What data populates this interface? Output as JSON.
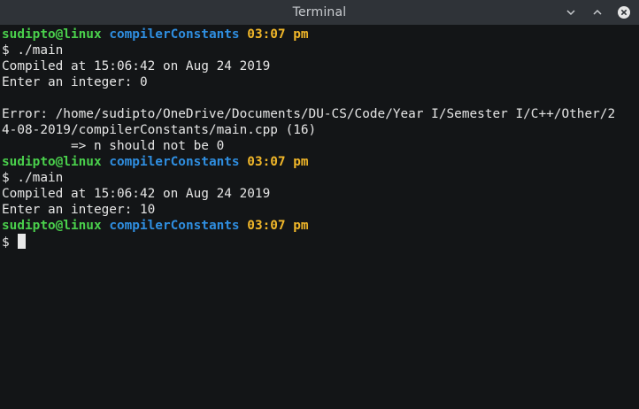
{
  "window": {
    "title": "Terminal",
    "controls": [
      "minimize-icon",
      "maximize-icon",
      "close-icon"
    ]
  },
  "colors": {
    "user": "#4ad04c",
    "directory": "#2f8ee0",
    "time": "#f0b629",
    "text": "#e6e6e6",
    "background": "#131517"
  },
  "prompt": {
    "user": "sudipto@linux",
    "directory": "compilerConstants",
    "time": "03:07 pm",
    "symbol": "$"
  },
  "lines": [
    {
      "type": "prompt"
    },
    {
      "type": "output",
      "text": "$ ./main"
    },
    {
      "type": "output",
      "text": "Compiled at 15:06:42 on Aug 24 2019"
    },
    {
      "type": "output",
      "text": "Enter an integer: 0"
    },
    {
      "type": "output",
      "text": ""
    },
    {
      "type": "output",
      "text": "Error: /home/sudipto/OneDrive/Documents/DU-CS/Code/Year I/Semester I/C++/Other/2"
    },
    {
      "type": "output",
      "text": "4-08-2019/compilerConstants/main.cpp (16)"
    },
    {
      "type": "output",
      "text": "         => n should not be 0"
    },
    {
      "type": "prompt"
    },
    {
      "type": "output",
      "text": "$ ./main"
    },
    {
      "type": "output",
      "text": "Compiled at 15:06:42 on Aug 24 2019"
    },
    {
      "type": "output",
      "text": "Enter an integer: 10"
    },
    {
      "type": "prompt"
    },
    {
      "type": "input",
      "text": "$"
    }
  ]
}
